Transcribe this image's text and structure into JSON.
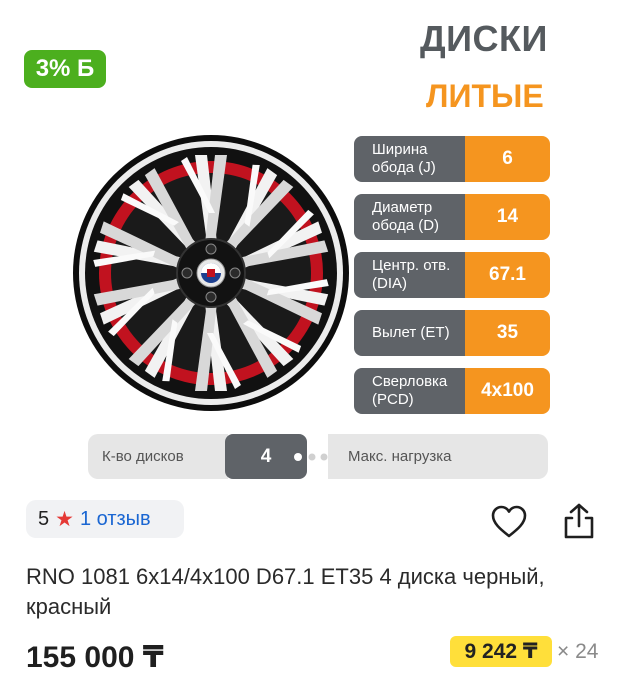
{
  "bonus_badge": "3% Б",
  "header": {
    "title": "ДИСКИ",
    "subtitle": "ЛИТЫЕ"
  },
  "specs": [
    {
      "label": "Ширина обода (J)",
      "value": "6"
    },
    {
      "label": "Диаметр обода (D)",
      "value": "14"
    },
    {
      "label": "Центр. отв. (DIA)",
      "value": "67.1"
    },
    {
      "label": "Вылет (ET)",
      "value": "35"
    },
    {
      "label": "Сверловка (PCD)",
      "value": "4x100"
    }
  ],
  "quantity": {
    "label": "К-во дисков",
    "value": "4",
    "load_label": "Макс. нагрузка"
  },
  "rating": {
    "score": "5",
    "reviews": "1 отзыв"
  },
  "product": {
    "title": "RNO 1081 6x14/4x100 D67.1 ET35 4 диска черный, красный"
  },
  "price": {
    "total": "155 000 ₸",
    "installment": "9 242 ₸",
    "installment_count": "× 24"
  },
  "icons": {
    "favorite": "heart-outline-icon",
    "share": "share-icon",
    "rating": "star-icon"
  },
  "colors": {
    "accent_orange": "#f5951f",
    "spec_gray": "#5f6368",
    "badge_green": "#4caf1e",
    "installment_yellow": "#ffdf3a",
    "wheel_red": "#c1121f"
  }
}
